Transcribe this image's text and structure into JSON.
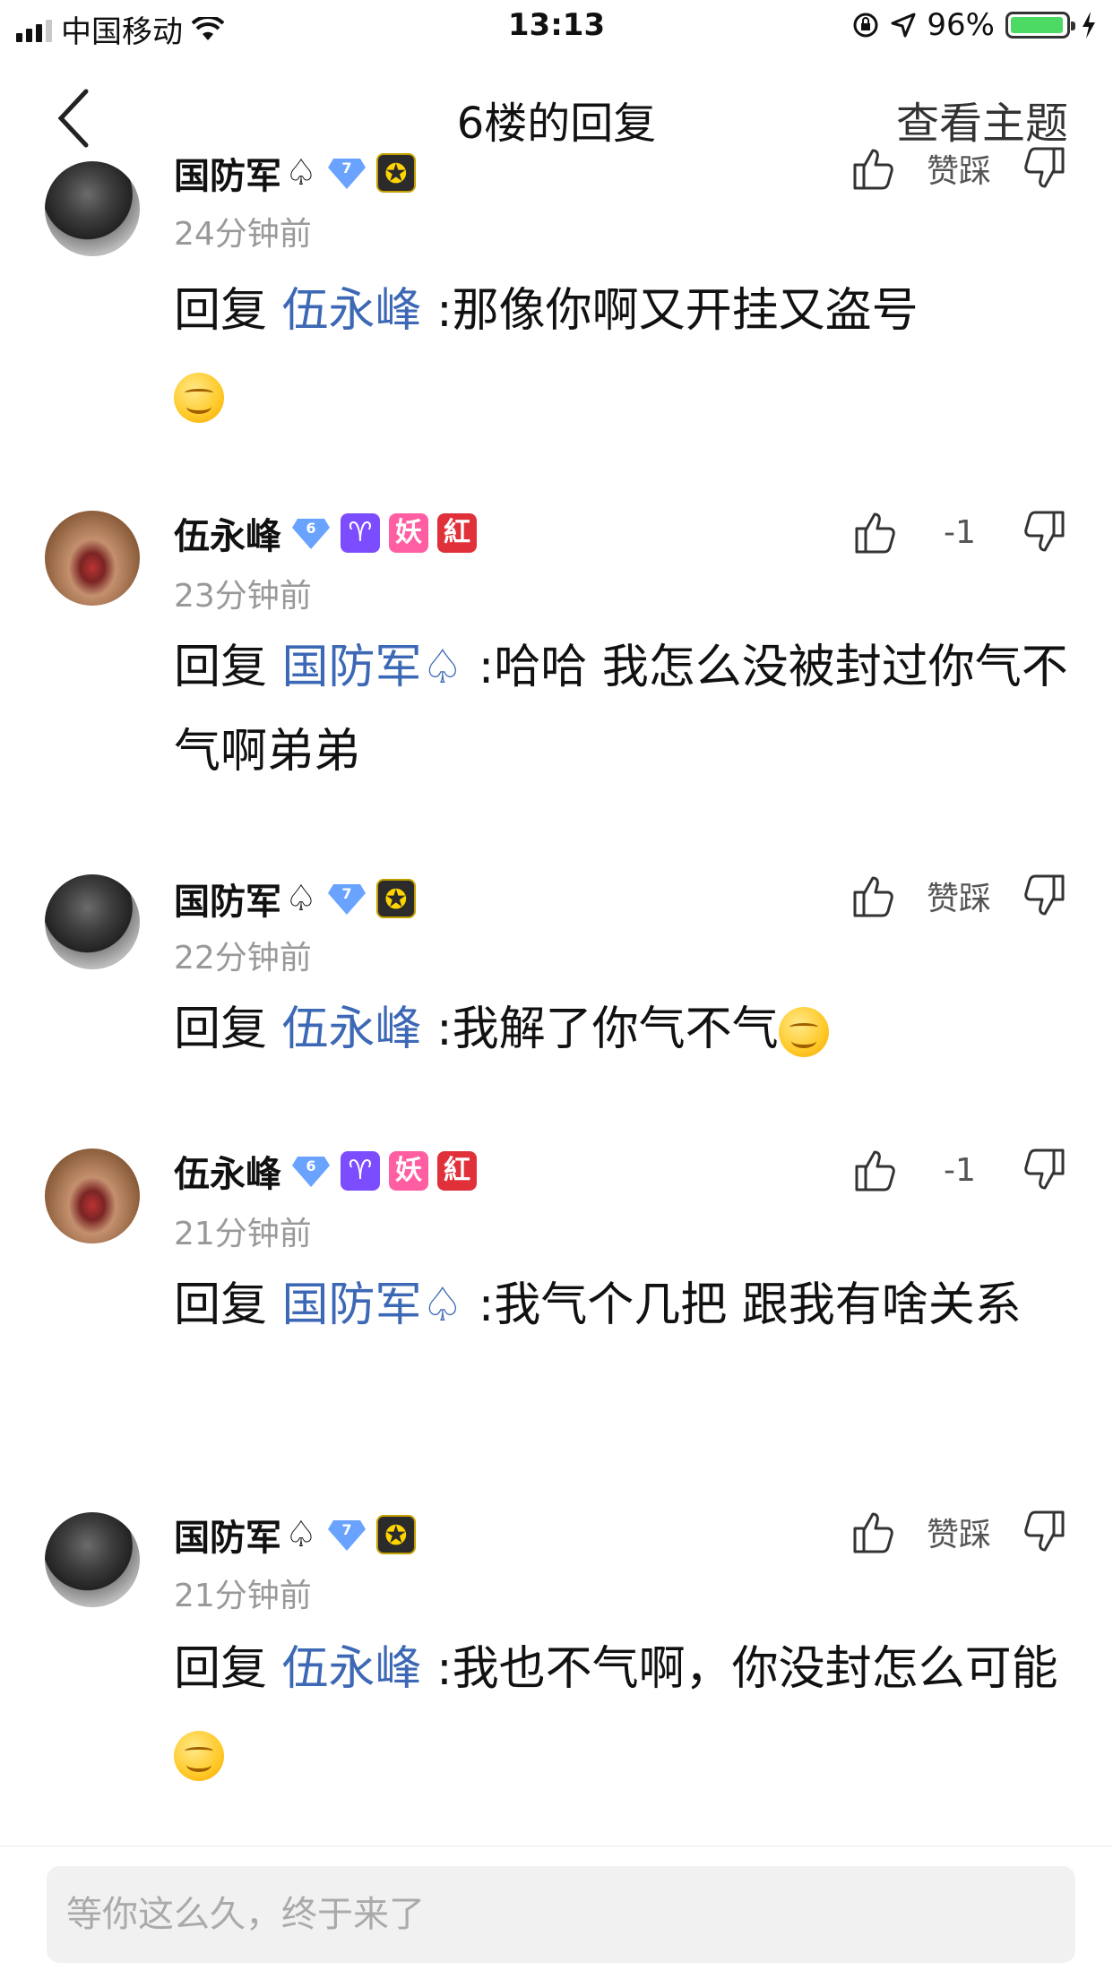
{
  "status": {
    "carrier": "中国移动",
    "time": "13:13",
    "battery": "96%",
    "battery_level": 0.96
  },
  "nav": {
    "title": "6楼的回复",
    "right_label": "查看主题"
  },
  "comments": [
    {
      "user": "国防军",
      "time": "24分钟前",
      "action_count": "赞踩",
      "reply_prefix": "回复 ",
      "reply_to": "伍永峰",
      "text": " :那像你啊又开挂又盗号"
    },
    {
      "user": "伍永峰",
      "time": "23分钟前",
      "action_count": "-1",
      "reply_prefix": "回复 ",
      "reply_to": "国防军",
      "text": " :哈哈 我怎么没被封过你气不气啊弟弟"
    },
    {
      "user": "国防军",
      "time": "22分钟前",
      "action_count": "赞踩",
      "reply_prefix": "回复 ",
      "reply_to": "伍永峰",
      "text": " :我解了你气不气"
    },
    {
      "user": "伍永峰",
      "time": "21分钟前",
      "action_count": "-1",
      "reply_prefix": "回复 ",
      "reply_to": "国防军",
      "text": " :我气个几把 跟我有啥关系"
    },
    {
      "user": "国防军",
      "time": "21分钟前",
      "action_count": "赞踩",
      "reply_prefix": "回复 ",
      "reply_to": "伍永峰",
      "text": " :我也不气啊，你没封怎么可能"
    }
  ],
  "badges": {
    "level_a": "7",
    "level_b": "6",
    "yao": "妖",
    "hong": "紅",
    "aries": "♈",
    "spade": "♤",
    "star": "✪"
  },
  "input": {
    "placeholder": "等你这么久，终于来了"
  }
}
